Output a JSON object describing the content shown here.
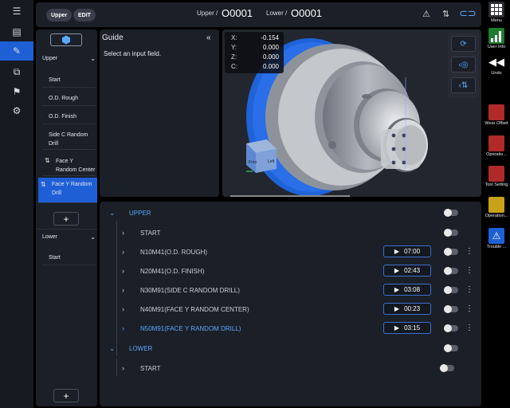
{
  "topbar": {
    "mode_upper": "Upper",
    "mode_edit": "EDIT",
    "upper_label": "Upper /",
    "upper_program": "O0001",
    "lower_label": "Lower /",
    "lower_program": "O0001"
  },
  "panel": {
    "upper_group": "Upper",
    "upper_items": [
      "Start",
      "O.D. Rough",
      "O.D. Finish",
      "Side C Random Drill",
      "Face Y Random Center",
      "Face Y Random Drill"
    ],
    "lower_group": "Lower",
    "lower_items": [
      "Start"
    ]
  },
  "guide": {
    "title": "Guide",
    "message": "Select an input field."
  },
  "coords": [
    {
      "axis": "X:",
      "value": "-0.154"
    },
    {
      "axis": "Y:",
      "value": "0.000"
    },
    {
      "axis": "Z:",
      "value": "0.000"
    },
    {
      "axis": "C:",
      "value": "0.000"
    }
  ],
  "viewcube": {
    "front": "Fron",
    "left": "Left"
  },
  "program_list": {
    "upper_header": "UPPER",
    "upper_start": "START",
    "processes": [
      {
        "name": "N10M41(O.D. ROUGH)",
        "time": "07:00",
        "color": "#c9ced8"
      },
      {
        "name": "N20M41(O.D. FINISH)",
        "time": "02:43",
        "color": "#c9ced8"
      },
      {
        "name": "N30M91(SIDE C RANDOM DRILL)",
        "time": "03:08",
        "color": "#c9ced8"
      },
      {
        "name": "N40M91(FACE Y RANDOM CENTER)",
        "time": "00:23",
        "color": "#c9ced8"
      },
      {
        "name": "N50M91(FACE Y RANDOM DRILL)",
        "time": "03:15",
        "color": "#5aa9ff"
      }
    ],
    "lower_header": "LOWER",
    "lower_start": "START"
  },
  "rightbar": {
    "menu": "Menu",
    "user_info": "User Info",
    "undo": "Undo",
    "wear_offset": "Wear Offset",
    "operation_1": "Operatio...",
    "tool_setting": "Tool Setting",
    "operation_2": "Operation...",
    "trouble": "Trouble ..."
  },
  "colors": {
    "accent": "#1f5fd6",
    "link": "#5aa9ff",
    "panel_bg": "#1b1f27"
  }
}
